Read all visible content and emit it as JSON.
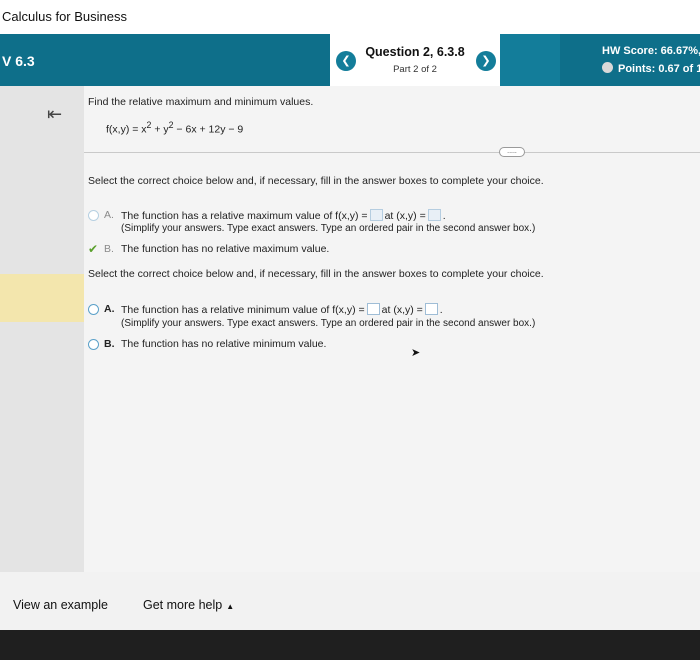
{
  "app": {
    "title": "Calculus for Business"
  },
  "header": {
    "section": "V 6.3",
    "question_title": "Question 2, 6.3.8",
    "question_part": "Part 2 of 2",
    "prev_icon": "chevron-left-icon",
    "next_icon": "chevron-right-icon",
    "hw_score": "HW Score: 66.67%,",
    "points": "Points: 0.67 of 1",
    "colors": {
      "header": "#137d9a",
      "header_dark": "#0e6f8a"
    }
  },
  "problem": {
    "prompt": "Find the relative maximum and minimum values.",
    "function": {
      "lhs": "f(x,y) = x",
      "sup1": "2",
      "mid": " + y",
      "sup2": "2",
      "rhs": " − 6x + 12y − 9"
    },
    "more_label": "....."
  },
  "part_max": {
    "instruction": "Select the correct choice below and, if necessary, fill in the answer boxes to complete your choice.",
    "option_a": {
      "letter": "A.",
      "text_before": "The function has a relative maximum value of f(x,y) =",
      "text_mid": "at (x,y) =",
      "text_end": ".",
      "note": "(Simplify your answers. Type exact answers. Type an ordered pair in the second answer box.)"
    },
    "option_b": {
      "letter": "B.",
      "text": "The function has no relative maximum value.",
      "selected": true
    }
  },
  "part_min": {
    "instruction": "Select the correct choice below and, if necessary, fill in the answer boxes to complete your choice.",
    "option_a": {
      "letter": "A.",
      "text_before": "The function has a relative minimum value of f(x,y) =",
      "text_mid": "at (x,y) =",
      "text_end": ".",
      "note": "(Simplify your answers. Type exact answers. Type an ordered pair in the second answer box.)"
    },
    "option_b": {
      "letter": "B.",
      "text": "The function has no relative minimum value."
    }
  },
  "footer": {
    "view_example": "View an example",
    "get_more_help": "Get more help",
    "caret": "▲"
  }
}
